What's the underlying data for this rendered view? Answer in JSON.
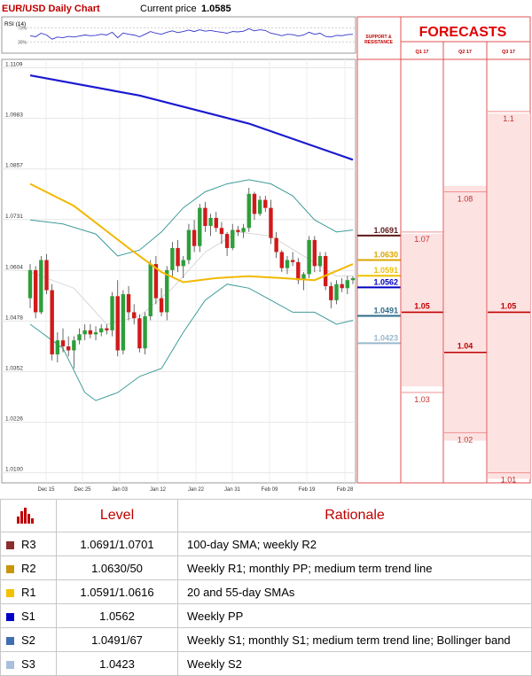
{
  "chart_data": {
    "type": "candlestick",
    "title": "EUR/USD Daily Chart",
    "current_price_label": "Current price",
    "current_price": "1.0585",
    "price_axis": {
      "ylim": [
        1.0075,
        1.113
      ],
      "tick_values": [
        1.1109,
        1.0983,
        1.0857,
        1.0731,
        1.0604,
        1.0478,
        1.0352,
        1.0226,
        1.01
      ],
      "tick_labels": [
        "1.1109",
        "1.0983",
        "1.0857",
        "1.0731",
        "1.0604",
        "1.0478",
        "1.0352",
        "1.0226",
        "1.0100"
      ]
    },
    "x_tick_labels": [
      "Dec 15",
      "Dec 25",
      "Jan 03",
      "Jan 12",
      "Jan 22",
      "Jan 31",
      "Feb 09",
      "Feb 19",
      "Feb 28"
    ],
    "rsi": {
      "label": "RSI (14)",
      "levels": [
        "70",
        "30"
      ]
    },
    "candles": [
      [
        1.0535,
        1.062,
        1.051,
        1.0605
      ],
      [
        1.0605,
        1.0615,
        1.0485,
        1.05
      ],
      [
        1.05,
        1.064,
        1.0495,
        1.063
      ],
      [
        1.063,
        1.0645,
        1.0545,
        1.0555
      ],
      [
        1.0555,
        1.057,
        1.038,
        1.0395
      ],
      [
        1.0395,
        1.045,
        1.0375,
        1.043
      ],
      [
        1.043,
        1.046,
        1.04,
        1.0415
      ],
      [
        1.0415,
        1.044,
        1.039,
        1.0405
      ],
      [
        1.0405,
        1.044,
        1.036,
        1.043
      ],
      [
        1.043,
        1.046,
        1.042,
        1.0445
      ],
      [
        1.0445,
        1.047,
        1.043,
        1.0455
      ],
      [
        1.0455,
        1.047,
        1.0435,
        1.0445
      ],
      [
        1.0445,
        1.0465,
        1.043,
        1.045
      ],
      [
        1.045,
        1.047,
        1.044,
        1.046
      ],
      [
        1.046,
        1.047,
        1.0445,
        1.0455
      ],
      [
        1.0455,
        1.055,
        1.044,
        1.054
      ],
      [
        1.054,
        1.058,
        1.039,
        1.0405
      ],
      [
        1.0405,
        1.0555,
        1.0395,
        1.0545
      ],
      [
        1.0545,
        1.0565,
        1.048,
        1.05
      ],
      [
        1.05,
        1.052,
        1.047,
        1.0485
      ],
      [
        1.0485,
        1.0495,
        1.04,
        1.041
      ],
      [
        1.041,
        1.05,
        1.0395,
        1.049
      ],
      [
        1.049,
        1.063,
        1.048,
        1.062
      ],
      [
        1.062,
        1.064,
        1.052,
        1.0535
      ],
      [
        1.0535,
        1.056,
        1.049,
        1.05
      ],
      [
        1.05,
        1.0615,
        1.048,
        1.0605
      ],
      [
        1.0605,
        1.0675,
        1.059,
        1.066
      ],
      [
        1.066,
        1.068,
        1.06,
        1.0615
      ],
      [
        1.0615,
        1.064,
        1.0585,
        1.063
      ],
      [
        1.063,
        1.072,
        1.062,
        1.0705
      ],
      [
        1.0705,
        1.073,
        1.065,
        1.0665
      ],
      [
        1.0665,
        1.077,
        1.065,
        1.076
      ],
      [
        1.076,
        1.0775,
        1.07,
        1.0715
      ],
      [
        1.0715,
        1.0745,
        1.069,
        1.0735
      ],
      [
        1.0735,
        1.075,
        1.07,
        1.071
      ],
      [
        1.071,
        1.0725,
        1.067,
        1.0695
      ],
      [
        1.0695,
        1.07,
        1.064,
        1.066
      ],
      [
        1.066,
        1.072,
        1.0655,
        1.0705
      ],
      [
        1.0705,
        1.0715,
        1.069,
        1.07
      ],
      [
        1.07,
        1.072,
        1.0685,
        1.071
      ],
      [
        1.071,
        1.081,
        1.07,
        1.0795
      ],
      [
        1.0795,
        1.08,
        1.073,
        1.0745
      ],
      [
        1.0745,
        1.079,
        1.074,
        1.078
      ],
      [
        1.078,
        1.079,
        1.075,
        1.076
      ],
      [
        1.076,
        1.078,
        1.067,
        1.0685
      ],
      [
        1.0685,
        1.07,
        1.0635,
        1.065
      ],
      [
        1.065,
        1.0655,
        1.06,
        1.061
      ],
      [
        1.061,
        1.064,
        1.0595,
        1.063
      ],
      [
        1.063,
        1.065,
        1.0615,
        1.0625
      ],
      [
        1.0625,
        1.0635,
        1.057,
        1.058
      ],
      [
        1.058,
        1.06,
        1.0555,
        1.0595
      ],
      [
        1.0595,
        1.069,
        1.0585,
        1.068
      ],
      [
        1.068,
        1.069,
        1.06,
        1.0615
      ],
      [
        1.0615,
        1.065,
        1.06,
        1.064
      ],
      [
        1.064,
        1.065,
        1.0555,
        1.0565
      ],
      [
        1.0565,
        1.0575,
        1.051,
        1.053
      ],
      [
        1.053,
        1.058,
        1.052,
        1.057
      ],
      [
        1.057,
        1.0585,
        1.055,
        1.056
      ],
      [
        1.056,
        1.059,
        1.0545,
        1.058
      ],
      [
        1.058,
        1.059,
        1.057,
        1.0585
      ]
    ],
    "sma_200": [
      [
        0,
        1.109
      ],
      [
        20,
        1.104
      ],
      [
        40,
        1.097
      ],
      [
        59,
        1.088
      ]
    ],
    "sma_55": [
      [
        0,
        1.082
      ],
      [
        8,
        1.0765
      ],
      [
        18,
        1.066
      ],
      [
        24,
        1.06
      ],
      [
        28,
        1.0575
      ],
      [
        34,
        1.0585
      ],
      [
        40,
        1.059
      ],
      [
        46,
        1.0585
      ],
      [
        52,
        1.058
      ],
      [
        59,
        1.062
      ]
    ],
    "bb_upper": [
      [
        0,
        1.073
      ],
      [
        6,
        1.072
      ],
      [
        12,
        1.0695
      ],
      [
        16,
        1.064
      ],
      [
        20,
        1.0655
      ],
      [
        24,
        1.07
      ],
      [
        28,
        1.076
      ],
      [
        32,
        1.08
      ],
      [
        36,
        1.082
      ],
      [
        40,
        1.083
      ],
      [
        44,
        1.082
      ],
      [
        48,
        1.079
      ],
      [
        52,
        1.073
      ],
      [
        56,
        1.07
      ],
      [
        59,
        1.0705
      ]
    ],
    "bb_lower": [
      [
        0,
        1.047
      ],
      [
        6,
        1.041
      ],
      [
        10,
        1.03
      ],
      [
        12,
        1.028
      ],
      [
        16,
        1.03
      ],
      [
        20,
        1.034
      ],
      [
        24,
        1.036
      ],
      [
        28,
        1.045
      ],
      [
        32,
        1.053
      ],
      [
        36,
        1.057
      ],
      [
        40,
        1.056
      ],
      [
        44,
        1.053
      ],
      [
        48,
        1.05
      ],
      [
        52,
        1.05
      ],
      [
        56,
        1.047
      ],
      [
        59,
        1.048
      ]
    ],
    "bb_mid": [
      [
        0,
        1.06
      ],
      [
        8,
        1.056
      ],
      [
        14,
        1.047
      ],
      [
        20,
        1.049
      ],
      [
        26,
        1.056
      ],
      [
        32,
        1.065
      ],
      [
        38,
        1.07
      ],
      [
        44,
        1.069
      ],
      [
        50,
        1.064
      ],
      [
        56,
        1.059
      ],
      [
        59,
        1.059
      ]
    ],
    "rsi_values": [
      48,
      45,
      55,
      50,
      38,
      44,
      42,
      46,
      44,
      47,
      50,
      48,
      49,
      52,
      50,
      58,
      42,
      56,
      52,
      50,
      45,
      52,
      60,
      55,
      52,
      58,
      62,
      57,
      60,
      64,
      60,
      65,
      61,
      63,
      60,
      58,
      55,
      60,
      59,
      61,
      68,
      62,
      65,
      63,
      55,
      52,
      48,
      52,
      51,
      47,
      50,
      58,
      52,
      55,
      46,
      44,
      49,
      48,
      51,
      52
    ],
    "support_resistance_header": [
      "SUPPORT &",
      "RESISTANCE"
    ],
    "levels": [
      {
        "name": "R3",
        "value": 1.0691,
        "label": "1.0691",
        "color": "#5e1a1a"
      },
      {
        "name": "R2",
        "value": 1.063,
        "label": "1.0630",
        "color": "#d9a500"
      },
      {
        "name": "R1",
        "value": 1.0591,
        "label": "1.0591",
        "color": "#f0c000"
      },
      {
        "name": "S1",
        "value": 1.0562,
        "label": "1.0562",
        "color": "#0000c0"
      },
      {
        "name": "S2",
        "value": 1.0491,
        "label": "1.0491",
        "color": "#2e6b8a"
      },
      {
        "name": "S3",
        "value": 1.0423,
        "label": "1.0423",
        "color": "#9ab8cc"
      }
    ],
    "forecasts": {
      "title": "FORECASTS",
      "columns": [
        {
          "label": "Q1 17",
          "range": [
            1.0315,
            1.0695
          ],
          "points": [
            {
              "value": 1.07,
              "label": "1.07",
              "bold": false
            },
            {
              "value": 1.05,
              "label": "1.05",
              "bold": true
            },
            {
              "value": 1.03,
              "label": "1.03",
              "bold": false
            }
          ]
        },
        {
          "label": "Q2 17",
          "range": [
            1.018,
            1.0815
          ],
          "points": [
            {
              "value": 1.08,
              "label": "1.08",
              "bold": false
            },
            {
              "value": 1.04,
              "label": "1.04",
              "bold": true
            },
            {
              "value": 1.02,
              "label": "1.02",
              "bold": false
            }
          ]
        },
        {
          "label": "Q3 17",
          "range": [
            1.0085,
            1.0995
          ],
          "points": [
            {
              "value": 1.1,
              "label": "1.1",
              "bold": false
            },
            {
              "value": 1.05,
              "label": "1.05",
              "bold": true
            },
            {
              "value": 1.01,
              "label": "1.01",
              "bold": false
            }
          ]
        }
      ]
    }
  },
  "table": {
    "headers": {
      "level": "Level",
      "rationale": "Rationale"
    },
    "rows": [
      {
        "key": "R3",
        "swatch": "#8b2e2e",
        "level": "1.0691/1.0701",
        "rationale": "100-day SMA; weekly R2"
      },
      {
        "key": "R2",
        "swatch": "#c8960a",
        "level": "1.0630/50",
        "rationale": "Weekly R1; monthly PP; medium term trend line"
      },
      {
        "key": "R1",
        "swatch": "#f2c200",
        "level": "1.0591/1.0616",
        "rationale": "20 and 55-day SMAs"
      },
      {
        "key": "S1",
        "swatch": "#0000c8",
        "level": "1.0562",
        "rationale": "Weekly PP"
      },
      {
        "key": "S2",
        "swatch": "#3f6fb0",
        "level": "1.0491/67",
        "rationale": "Weekly S1; monthly S1; medium term trend line; Bollinger band"
      },
      {
        "key": "S3",
        "swatch": "#a8c0dc",
        "level": "1.0423",
        "rationale": "Weekly S2"
      }
    ]
  }
}
